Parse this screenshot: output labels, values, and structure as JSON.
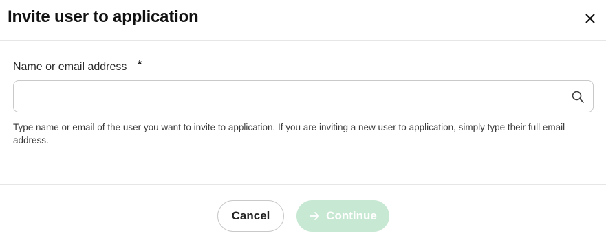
{
  "dialog": {
    "title": "Invite user to application",
    "close_icon": "close-icon"
  },
  "field": {
    "label": "Name or email address",
    "required_mark": "*",
    "value": "",
    "placeholder": "",
    "icon": "search-icon",
    "helper": "Type name or email of the user you want to invite to application. If you are inviting a new user to application, simply type their full email address."
  },
  "footer": {
    "cancel_label": "Cancel",
    "continue_label": "Continue",
    "continue_icon": "arrow-right-icon",
    "continue_enabled": false
  },
  "colors": {
    "continue_disabled_bg": "#c7e8d2",
    "border": "#c9c9c9",
    "divider": "#e6e6e6"
  }
}
